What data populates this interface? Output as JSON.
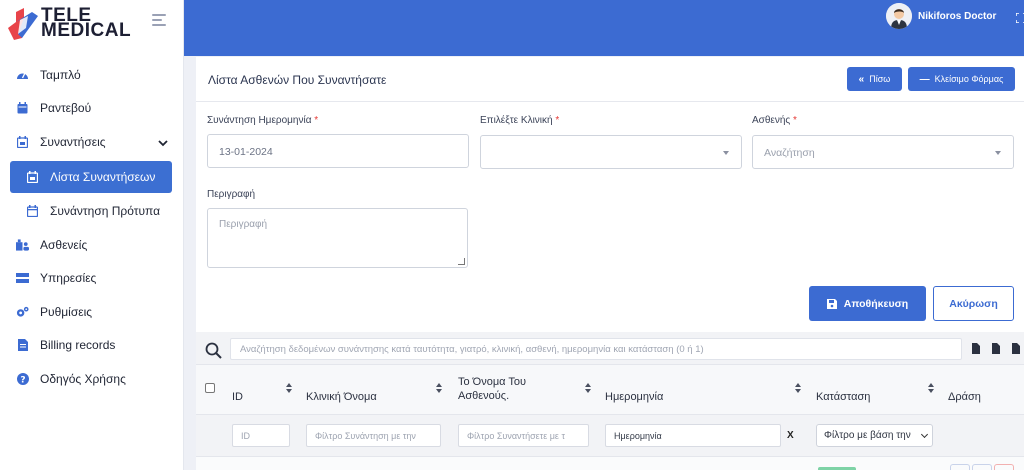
{
  "brand": {
    "line1": "TELE",
    "line2": "MEDICAL",
    "colors": {
      "blue": "#3c6bd2",
      "red": "#e8444a",
      "dark": "#1d1f33"
    }
  },
  "sidebar": {
    "items": [
      {
        "label": "Ταμπλό",
        "icon": "dashboard-icon"
      },
      {
        "label": "Ραντεβού",
        "icon": "calendar-icon"
      },
      {
        "label": "Συναντήσεις",
        "icon": "calendar-check-icon",
        "expanded": true
      },
      {
        "label": "Λίστα Συναντήσεων",
        "icon": "calendar-check-icon",
        "active": true
      },
      {
        "label": "Συνάντηση Πρότυπα",
        "icon": "calendar-icon"
      },
      {
        "label": "Ασθενείς",
        "icon": "patients-icon"
      },
      {
        "label": "Υπηρεσίες",
        "icon": "services-icon"
      },
      {
        "label": "Ρυθμίσεις",
        "icon": "gears-icon"
      },
      {
        "label": "Billing records",
        "icon": "file-icon"
      },
      {
        "label": "Οδηγός Χρήσης",
        "icon": "help-icon"
      }
    ]
  },
  "topbar": {
    "user_name": "Nikiforos Doctor"
  },
  "form": {
    "title": "Λίστα Ασθενών Που Συναντήσατε",
    "back_label": "Πίσω",
    "close_label": "Κλείσιμο Φόρμας",
    "date_label": "Συνάντηση Ημερομηνία",
    "date_value": "13-01-2024",
    "clinic_label": "Επιλέξτε Κλινική",
    "clinic_value": "",
    "patient_label": "Ασθενής",
    "patient_placeholder": "Αναζήτηση",
    "required_mark": "*",
    "description_label": "Περιγραφή",
    "description_placeholder": "Περιγραφή",
    "save_label": "Αποθήκευση",
    "cancel_label": "Ακύρωση"
  },
  "table": {
    "search_placeholder": "Αναζήτηση δεδομένων συνάντησης κατά ταυτότητα, γιατρό, κλινική, ασθενή, ημερομηνία και κατάσταση (0 ή 1)",
    "columns": {
      "id": "ID",
      "clinic": "Κλινική Όνομα",
      "patient_line1": "Το Όνομα Του",
      "patient_line2": "Ασθενούς.",
      "date": "Ημερομηνία",
      "status": "Κατάσταση",
      "action": "Δράση"
    },
    "filters": {
      "id_placeholder": "ID",
      "clinic_placeholder": "Φίλτρο Συνάντηση με την",
      "patient_placeholder": "Φίλτρο Συναντήσετε με τ",
      "date_value": "Ημερομηνία",
      "clear_label": "X",
      "status_value": "Φίλτρο με βάση την"
    }
  }
}
